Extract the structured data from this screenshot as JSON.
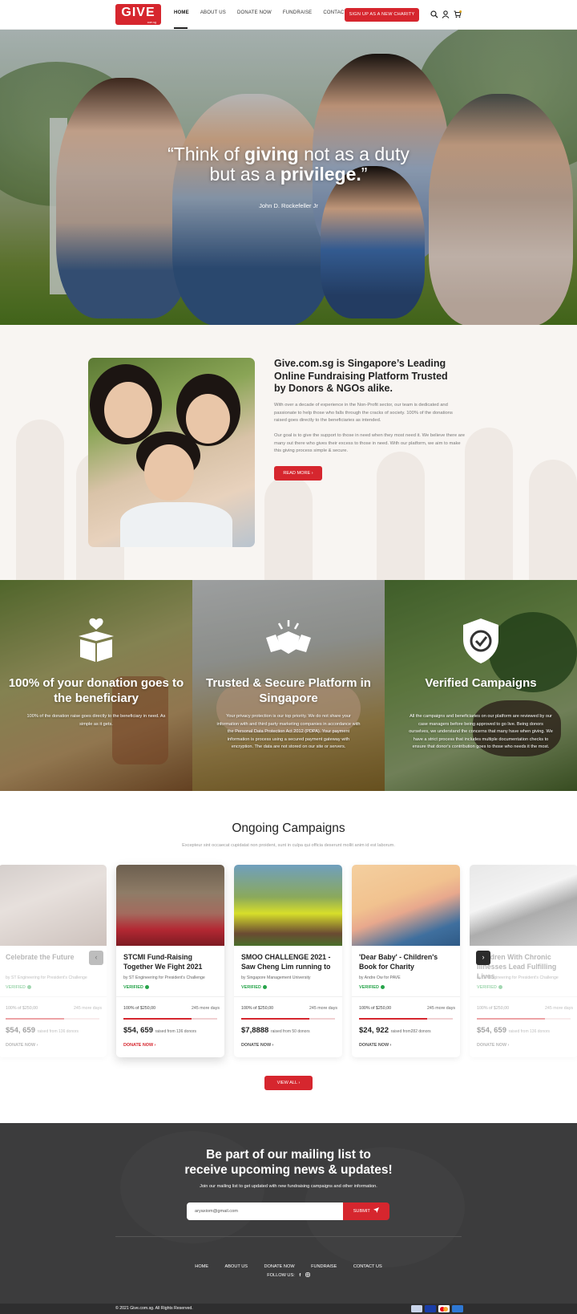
{
  "header": {
    "logo_text": "GIVE",
    "logo_sub": "com.sg",
    "nav": [
      "HOME",
      "ABOUT US",
      "DONATE NOW",
      "FUNDRAISE",
      "CONTACT US"
    ],
    "signup_label": "SIGN UP AS A NEW CHARITY",
    "icons": [
      "search-icon",
      "user-icon",
      "cart-icon"
    ]
  },
  "hero": {
    "quote_line1_pre": "“Think of ",
    "quote_line1_bold": "giving",
    "quote_line1_post": " not as a duty",
    "quote_line2_pre": "but as a ",
    "quote_line2_bold": "privilege.",
    "quote_line2_post": "”",
    "author": "John D. Rockefeller Jr"
  },
  "about": {
    "title": "Give.com.sg is Singapore’s Leading Online Fundraising Platform Trusted by Donors & NGOs alike.",
    "p1": "With over a decade of experience in the Non-Profit sector, our team is dedicated and passionate to help those who falls through the cracks of society. 100% of the donations raised goes directly to the beneficiaries as intended.",
    "p2": "Our goal is to give the support to those in need when they most need it. We believe there are many out there who gives their excess to those in need. With our platform, we aim to make this giving process simple & secure.",
    "read_more": "READ MORE"
  },
  "features": [
    {
      "icon": "gift-box-heart-icon",
      "title": "100% of your donation goes to the beneficiary",
      "text": "100% of the donation raise goes directly to the beneficiary in need. As simple as it gets."
    },
    {
      "icon": "handshake-icon",
      "title": "Trusted & Secure Platform in Singapore",
      "text": "Your privacy protection is our top priority. We do not share your information with and third party marketing companies in accordance with the Personal Data Protection Act 2012 (PDPA). Your payment information is process using a secured payment gateway with encryption. The data are not stored on our site or servers."
    },
    {
      "icon": "shield-check-icon",
      "title": "Verified Campaigns",
      "text": "All the campaigns and beneficiaries on our platform are reviewed by our case managers before being approved to go live. Being donors ourselves, we understand the concerns that many have when giving. We have a strict process that includes multiple documentation checks to ensure that donor's contribution goes to those who needs it the most."
    }
  ],
  "campaigns": {
    "title": "Ongoing Campaigns",
    "subtitle": "Excepteur sint occaecat cupidatat non proident, sunt in culpa qui officia deserunt mollit anim id est laborum.",
    "verified_label": "VERIFIED",
    "view_all": "VIEW ALL",
    "items": [
      {
        "title": "Celebrate the Future",
        "by": "by ST Engineering for President's Challenge",
        "pct": "100% of $250,00",
        "days": "245 more days",
        "progress": 0.62,
        "amount": "$54, 659",
        "donors": "raised from 136 donors",
        "donate": "DONATE NOW"
      },
      {
        "title": "STCMI Fund-Raising Together We Fight 2021",
        "by": "by ST Engineering for President's Challenge",
        "pct": "100% of $250,00",
        "days": "245 more days",
        "progress": 0.73,
        "amount": "$54, 659",
        "donors": "raised from 136 donors",
        "donate": "DONATE NOW"
      },
      {
        "title": "SMOO CHALLENGE 2021 - Saw Cheng Lim running to",
        "by": "by Singapore Management University",
        "pct": "100% of $250,00",
        "days": "245 more days",
        "progress": 0.73,
        "amount": "$7,8888",
        "donors": "raised from 50 donors",
        "donate": "DONATE NOW"
      },
      {
        "title": "'Dear Baby' - Children's Book for Charity",
        "by": "by Andre Ow for PAVE",
        "pct": "100% of $250,00",
        "days": "245 more days",
        "progress": 0.73,
        "amount": "$24, 922",
        "donors": "raised from282 donors",
        "donate": "DONATE NOW"
      },
      {
        "title": "Children With Chronic Illnesses Lead Fulfilling Lives",
        "by": "by ST Engineering for President's Challenge",
        "pct": "100% of $250,00",
        "days": "245 more days",
        "progress": 0.73,
        "amount": "$54, 659",
        "donors": "raised from 136 donors",
        "donate": "DONATE NOW"
      }
    ]
  },
  "mailing": {
    "title_line1": "Be part of our mailing list to",
    "title_line2": "receive upcoming news & updates!",
    "subtitle": "Join our mailing list to get updated with new fundraising campaigns and other information.",
    "email_value": "aryaxiom@gmail.com",
    "submit": "SUBMIT"
  },
  "footer": {
    "nav": [
      "HOME",
      "ABOUT US",
      "DONATE NOW",
      "FUNDRAISE",
      "CONTACT US"
    ],
    "follow": "FOLLOW US:",
    "copyright": "© 2021 Give.com.sg. All Rights Reserved.",
    "payment_icons": [
      "paypal-icon",
      "visa-icon",
      "mastercard-icon",
      "amex-icon"
    ]
  },
  "colors": {
    "accent": "#d6262e",
    "verified": "#27a44a",
    "dark": "#3c3c3d"
  }
}
